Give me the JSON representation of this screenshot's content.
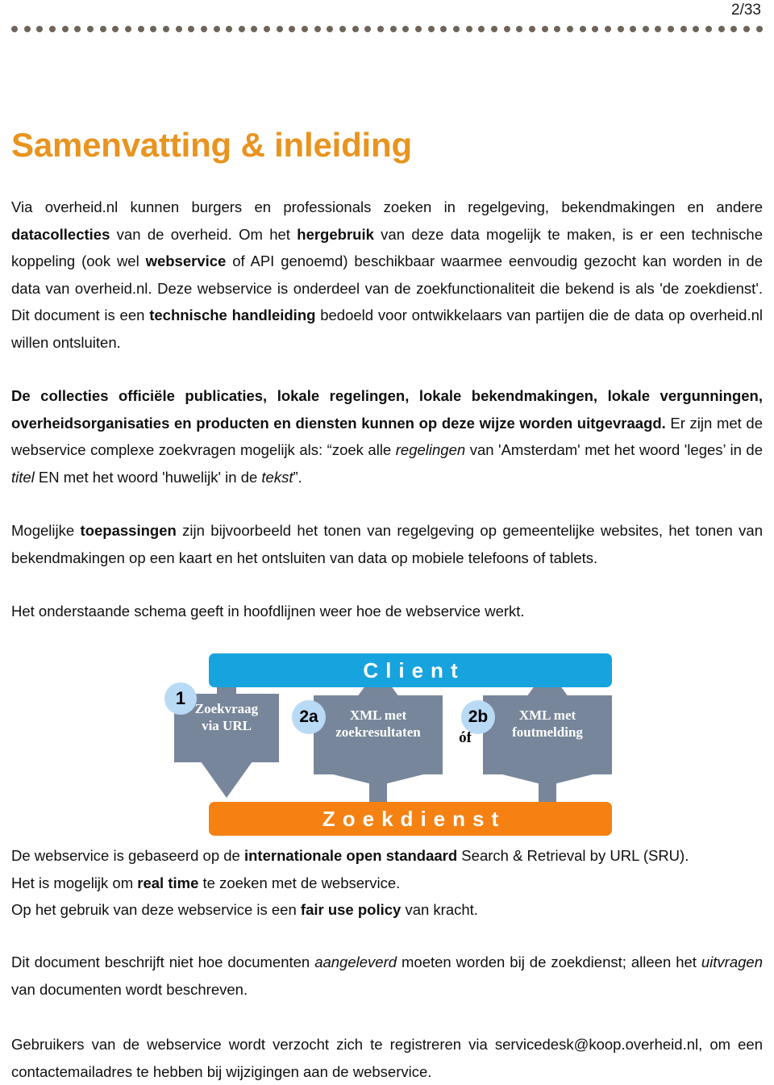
{
  "header": {
    "page_number": "2/33",
    "rule_dot_count": 60,
    "rule_dot_color": "#6e6459"
  },
  "title": {
    "text": "Samenvatting & inleiding",
    "color": "#e8941f"
  },
  "paragraphs": {
    "p1": {
      "seg1": "Via overheid.nl kunnen burgers en professionals zoeken in regelgeving, bekendmakingen en andere ",
      "b1": "datacollecties",
      "seg2": " van de overheid. Om het ",
      "b2": "hergebruik",
      "seg3": " van deze data mogelijk te maken, is er een technische koppeling (ook wel ",
      "b3": "webservice",
      "seg4": " of API genoemd) beschikbaar waarmee eenvoudig gezocht kan worden in de data van overheid.nl. Deze webservice is onderdeel van de zoekfunctionaliteit die bekend is als 'de zoekdienst'.  Dit document is een ",
      "b4": "technische handleiding",
      "seg5": " bedoeld voor ontwikkelaars van partijen die de data op overheid.nl willen ontsluiten."
    },
    "p2": {
      "b1": "De collecties officiële publicaties, lokale regelingen, lokale bekendmakingen, lokale vergunningen, overheidsorganisaties en producten en diensten kunnen op deze wijze worden uitgevraagd.",
      "seg1": " Er zijn met de webservice complexe zoekvragen mogelijk als: “zoek alle ",
      "i1": "regelingen",
      "seg2": " van 'Amsterdam' met het woord 'leges’ in de ",
      "i2": "titel",
      "seg3": " EN met het woord 'huwelijk' in de ",
      "i3": "tekst",
      "seg4": "”."
    },
    "p3": {
      "seg1": "Mogelijke ",
      "b1": "toepassingen",
      "seg2": " zijn bijvoorbeeld het tonen van regelgeving op  gemeentelijke websites, het tonen van bekendmakingen op een kaart en het ontsluiten van data op mobiele telefoons of tablets."
    },
    "p4": {
      "seg1": "Het onderstaande schema geeft in hoofdlijnen weer hoe de webservice werkt."
    },
    "p5": {
      "seg1": "De webservice is gebaseerd op de ",
      "b1": "internationale open standaard",
      "seg2": " Search & Retrieval by URL (SRU)."
    },
    "p6": {
      "seg1": "Het is mogelijk om ",
      "b1": "real time",
      "seg2": " te zoeken met de webservice."
    },
    "p7": {
      "seg1": "Op het gebruik van deze webservice is een ",
      "b1": "fair use policy",
      "seg2": " van kracht."
    },
    "p8": {
      "seg1": "Dit document beschrijft niet hoe documenten ",
      "i1": "aangeleverd",
      "seg2": " moeten worden bij de zoekdienst; alleen het ",
      "i2": "uitvragen",
      "seg3": " van documenten wordt beschreven."
    },
    "p9": {
      "seg1": "Gebruikers van de webservice wordt verzocht zich te registreren via servicedesk@koop.overheid.nl, om een contactemailadres te hebben bij wijzigingen aan de webservice."
    }
  },
  "diagram": {
    "client_label": "Client",
    "client_color": "#17a3dd",
    "zoekdienst_label": "Zoekdienst",
    "zoekdienst_color": "#f58113",
    "arrow_color": "#77869a",
    "badge_color": "#b9daf5",
    "steps": [
      {
        "badge": "1",
        "line1": "Zoekvraag",
        "line2": "via URL",
        "direction": "down"
      },
      {
        "badge": "2a",
        "line1": "XML met",
        "line2": "zoekresultaten",
        "direction": "up"
      },
      {
        "badge": "2b",
        "line1": "XML met",
        "line2": "foutmelding",
        "direction": "up"
      }
    ],
    "separator_label": "óf"
  }
}
